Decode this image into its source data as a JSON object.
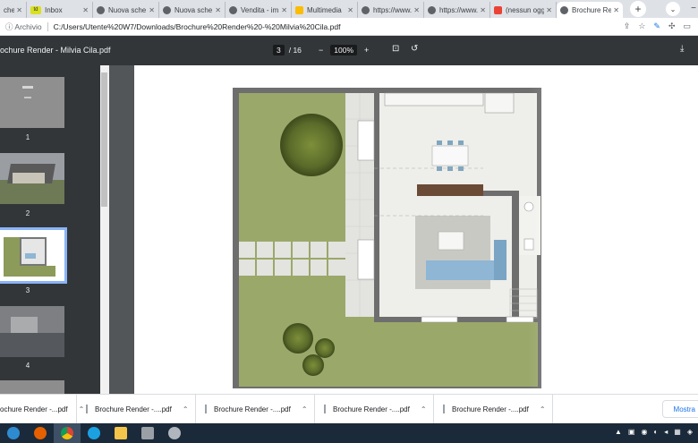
{
  "tabs": [
    {
      "title": "che",
      "favicon_color": "#8ab4f8"
    },
    {
      "title": "Inbox",
      "favicon_color": "#f4c20d"
    },
    {
      "title": "Nuova sche",
      "favicon_color": "#5f6368"
    },
    {
      "title": "Nuova sche",
      "favicon_color": "#5f6368"
    },
    {
      "title": "Vendita - im",
      "favicon_color": "#5f6368"
    },
    {
      "title": "Multimedia",
      "favicon_color": "#fbbc04"
    },
    {
      "title": "https://www.",
      "favicon_color": "#5f6368"
    },
    {
      "title": "https://www.",
      "favicon_color": "#5f6368"
    },
    {
      "title": "(nessun ogg",
      "favicon_color": "#ea4335"
    },
    {
      "title": "Brochure Re",
      "favicon_color": "#5f6368",
      "active": true
    }
  ],
  "inbox_icon_text": "td",
  "address": {
    "info": "Archivio",
    "url": "C:/Users/Utente%20W7/Downloads/Brochure%20Render%20-%20Milvia%20Cila.pdf"
  },
  "pdf": {
    "title": "ochure Render - Milvia Cila.pdf",
    "current_page": "3",
    "total_pages": "/ 16",
    "zoom": "100%",
    "zoom_out": "−",
    "zoom_in": "+"
  },
  "thumbnails": [
    {
      "label": "1"
    },
    {
      "label": "2"
    },
    {
      "label": "3",
      "selected": true
    },
    {
      "label": "4"
    }
  ],
  "downloads": [
    {
      "name": "ochure Render -...pdf"
    },
    {
      "name": "Brochure Render -....pdf"
    },
    {
      "name": "Brochure Render -....pdf"
    },
    {
      "name": "Brochure Render -....pdf"
    },
    {
      "name": "Brochure Render -....pdf"
    }
  ],
  "show_all": "Mostra",
  "icons": {
    "close": "✕",
    "new_tab": "+",
    "chevron": "⌃",
    "download": "⤓",
    "more": "⋮"
  },
  "colors": {
    "toolbar": "#323639",
    "viewer_bg": "#525659",
    "grass": "#9aa86a",
    "wall": "#7a7a7a",
    "sofa": "#8fb6d4"
  }
}
